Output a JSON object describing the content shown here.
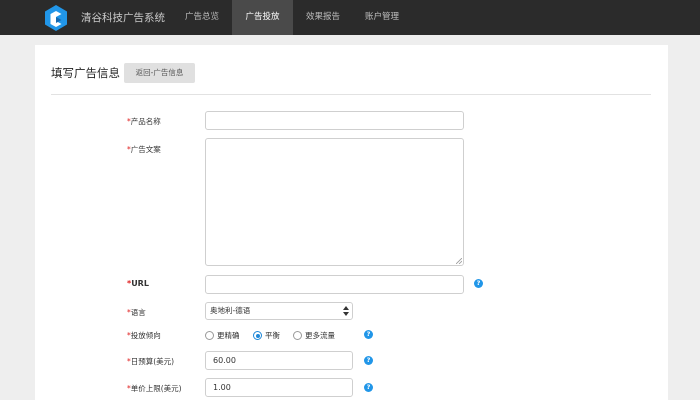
{
  "header": {
    "brand": "清谷科技广告系统",
    "nav": [
      {
        "label": "广告总览",
        "active": false
      },
      {
        "label": "广告投放",
        "active": true
      },
      {
        "label": "效果报告",
        "active": false
      },
      {
        "label": "账户管理",
        "active": false
      }
    ]
  },
  "page": {
    "title": "填写广告信息",
    "back_button": "返回-广告信息"
  },
  "form": {
    "required_mark": "*",
    "product_name": {
      "label": "产品名称",
      "value": ""
    },
    "ad_copy": {
      "label": "广告文案",
      "value": ""
    },
    "url": {
      "label": "URL",
      "value": ""
    },
    "language": {
      "label": "语言",
      "selected": "奥地利-德语"
    },
    "bias": {
      "label": "投放倾向",
      "options": [
        {
          "label": "更精确",
          "checked": false
        },
        {
          "label": "平衡",
          "checked": true
        },
        {
          "label": "更多流量",
          "checked": false
        }
      ]
    },
    "daily_budget": {
      "label": "日预算(美元)",
      "value": "60.00"
    },
    "max_cpc": {
      "label": "单价上限(美元)",
      "value": "1.00"
    },
    "help_icon": "?"
  },
  "colors": {
    "topbar": "#2b2b2b",
    "nav_active": "#4a4a4a",
    "logo_blue": "#2196e8",
    "required_red": "#e02020",
    "help_blue": "#2196e8"
  }
}
